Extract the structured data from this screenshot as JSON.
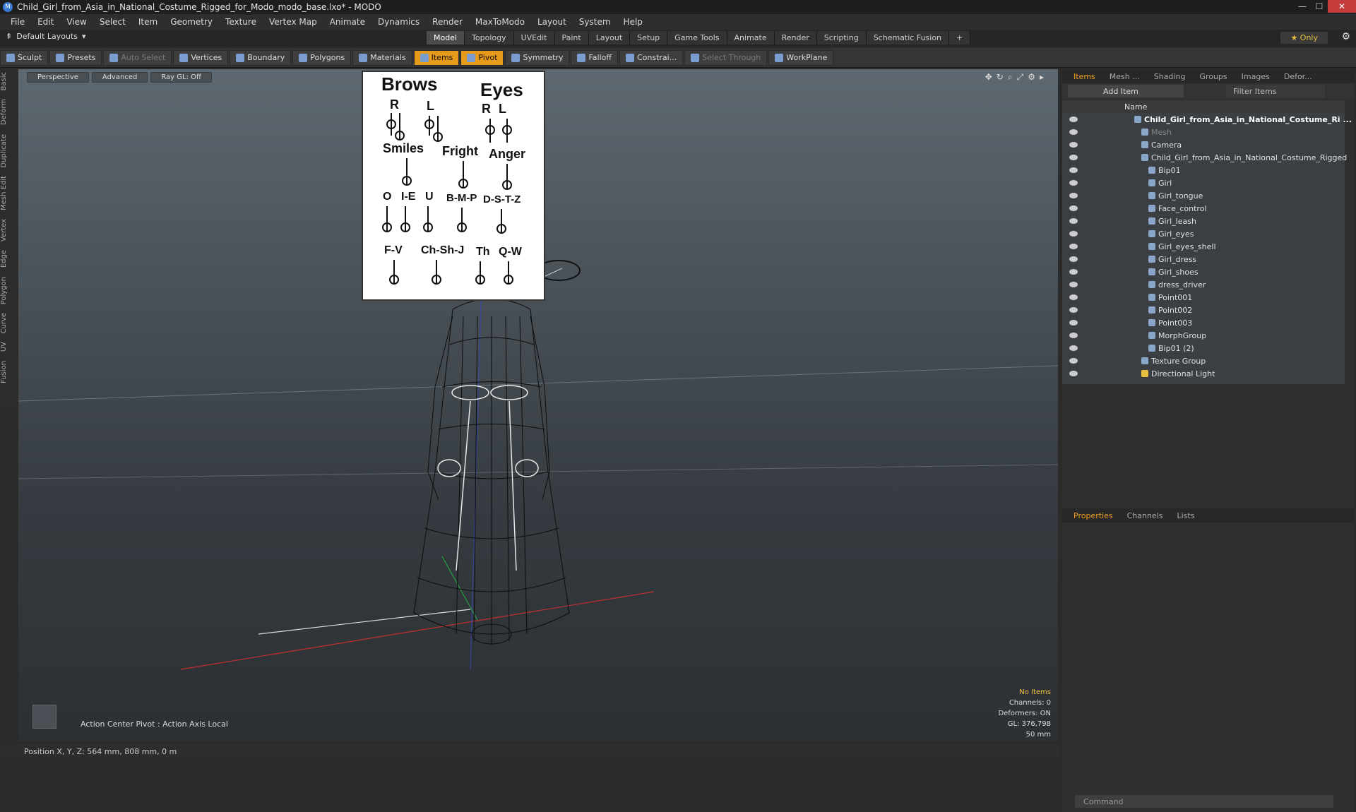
{
  "window": {
    "title": "Child_Girl_from_Asia_in_National_Costume_Rigged_for_Modo_modo_base.lxo* - MODO",
    "min": "—",
    "max": "☐",
    "close": "✕"
  },
  "menu": [
    "File",
    "Edit",
    "View",
    "Select",
    "Item",
    "Geometry",
    "Texture",
    "Vertex Map",
    "Animate",
    "Dynamics",
    "Render",
    "MaxToModo",
    "Layout",
    "System",
    "Help"
  ],
  "layouts_label": "Default Layouts",
  "main_tabs": [
    "Model",
    "Topology",
    "UVEdit",
    "Paint",
    "Layout",
    "Setup",
    "Game Tools",
    "Animate",
    "Render",
    "Scripting",
    "Schematic Fusion"
  ],
  "only_label": "Only",
  "toolbar": {
    "sculpt": "Sculpt",
    "presets": "Presets",
    "auto_select": "Auto Select",
    "vertices": "Vertices",
    "boundary": "Boundary",
    "polygons": "Polygons",
    "materials": "Materials",
    "items": "Items",
    "pivot": "Pivot",
    "symmetry": "Symmetry",
    "falloff": "Falloff",
    "constrain": "Constrai...",
    "select_through": "Select Through",
    "workplane": "WorkPlane"
  },
  "left_tabs": [
    "Basic",
    "Deform",
    "Duplicate",
    "Mesh Edit",
    "Vertex",
    "Edge",
    "Polygon",
    "Curve",
    "UV",
    "Fusion"
  ],
  "viewport": {
    "perspective": "Perspective",
    "advanced": "Advanced",
    "raygl": "Ray GL: Off",
    "action_center": "Action Center Pivot : Action Axis Local",
    "status": {
      "no_items": "No Items",
      "channels": "Channels: 0",
      "deformers": "Deformers: ON",
      "gl": "GL: 376,798",
      "size": "50 mm"
    }
  },
  "face_panel": {
    "brows": "Brows",
    "eyes": "Eyes",
    "r1": "R",
    "l1": "L",
    "r2": "R",
    "l2": "L",
    "smiles": "Smiles",
    "fright": "Fright",
    "anger": "Anger",
    "o": "O",
    "ie": "I-E",
    "u": "U",
    "bmp": "B-M-P",
    "dstz": "D-S-T-Z",
    "fv": "F-V",
    "chshj": "Ch-Sh-J",
    "th": "Th",
    "qw": "Q-W"
  },
  "statusbar": "Position X, Y, Z:  564 mm, 808 mm, 0 m",
  "right_panel": {
    "tabs": [
      "Items",
      "Mesh ...",
      "Shading",
      "Groups",
      "Images",
      "Defor..."
    ],
    "add_item": "Add Item",
    "filter": "Filter Items",
    "name_header": "Name",
    "tree": [
      {
        "label": "Child_Girl_from_Asia_in_National_Costume_Ri ...",
        "style": "bold"
      },
      {
        "label": "Mesh",
        "style": "dim"
      },
      {
        "label": "Camera",
        "style": ""
      },
      {
        "label": "Child_Girl_from_Asia_in_National_Costume_Rigged",
        "style": ""
      },
      {
        "label": "Bip01",
        "style": ""
      },
      {
        "label": "Girl",
        "style": ""
      },
      {
        "label": "Girl_tongue",
        "style": ""
      },
      {
        "label": "Face_control",
        "style": ""
      },
      {
        "label": "Girl_leash",
        "style": ""
      },
      {
        "label": "Girl_eyes",
        "style": ""
      },
      {
        "label": "Girl_eyes_shell",
        "style": ""
      },
      {
        "label": "Girl_dress",
        "style": ""
      },
      {
        "label": "Girl_shoes",
        "style": ""
      },
      {
        "label": "dress_driver",
        "style": ""
      },
      {
        "label": "Point001",
        "style": ""
      },
      {
        "label": "Point002",
        "style": ""
      },
      {
        "label": "Point003",
        "style": ""
      },
      {
        "label": "MorphGroup",
        "style": ""
      },
      {
        "label": "Bip01 (2)",
        "style": ""
      },
      {
        "label": "Texture Group",
        "style": ""
      },
      {
        "label": "Directional Light",
        "style": ""
      }
    ],
    "props_tabs": [
      "Properties",
      "Channels",
      "Lists"
    ],
    "command_placeholder": "Command"
  }
}
